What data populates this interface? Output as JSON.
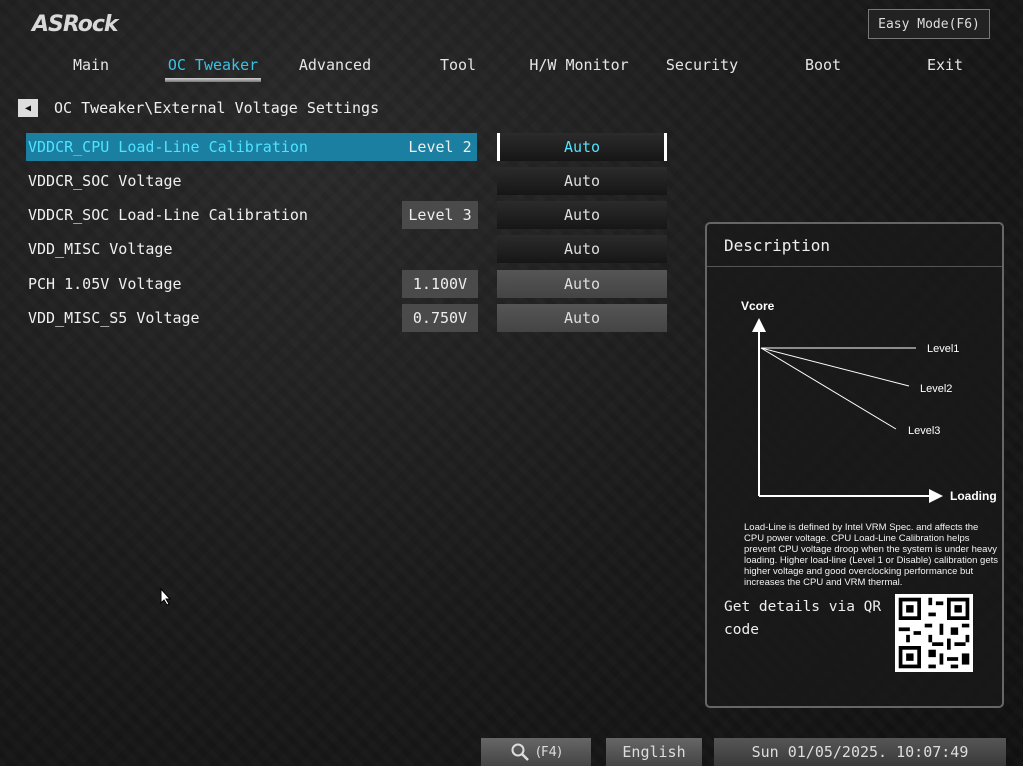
{
  "brand": "ASRock",
  "easy_mode_label": "Easy Mode(F6)",
  "nav": [
    {
      "label": "Main"
    },
    {
      "label": "OC Tweaker"
    },
    {
      "label": "Advanced"
    },
    {
      "label": "Tool"
    },
    {
      "label": "H/W Monitor"
    },
    {
      "label": "Security"
    },
    {
      "label": "Boot"
    },
    {
      "label": "Exit"
    }
  ],
  "active_tab": "OC Tweaker",
  "breadcrumb": "OC Tweaker\\External Voltage Settings",
  "settings": [
    {
      "label": "VDDCR_CPU Load-Line Calibration",
      "current": "Level 2",
      "value": "Auto"
    },
    {
      "label": "VDDCR_SOC Voltage",
      "current": "",
      "value": "Auto"
    },
    {
      "label": "VDDCR_SOC Load-Line Calibration",
      "current": "Level 3",
      "value": "Auto"
    },
    {
      "label": "VDD_MISC Voltage",
      "current": "",
      "value": "Auto"
    },
    {
      "label": "PCH 1.05V Voltage",
      "current": "1.100V",
      "value": "Auto"
    },
    {
      "label": "VDD_MISC_S5 Voltage",
      "current": "0.750V",
      "value": "Auto"
    }
  ],
  "description": {
    "title": "Description",
    "chart": {
      "y_label": "Vcore",
      "x_label": "Loading",
      "lines": [
        "Level1",
        "Level2",
        "Level3"
      ]
    },
    "text": "Load-Line is defined by Intel VRM Spec. and affects the CPU power voltage. CPU Load-Line Calibration helps prevent CPU voltage droop when the system is under heavy loading. Higher load-line (Level 1 or Disable) calibration gets higher voltage and good overclocking performance but increases the CPU and VRM thermal.",
    "qr_text": "Get details via QR code"
  },
  "bottom": {
    "search_label": "(F4)",
    "language": "English",
    "datetime": "Sun 01/05/2025. 10:07:49"
  }
}
